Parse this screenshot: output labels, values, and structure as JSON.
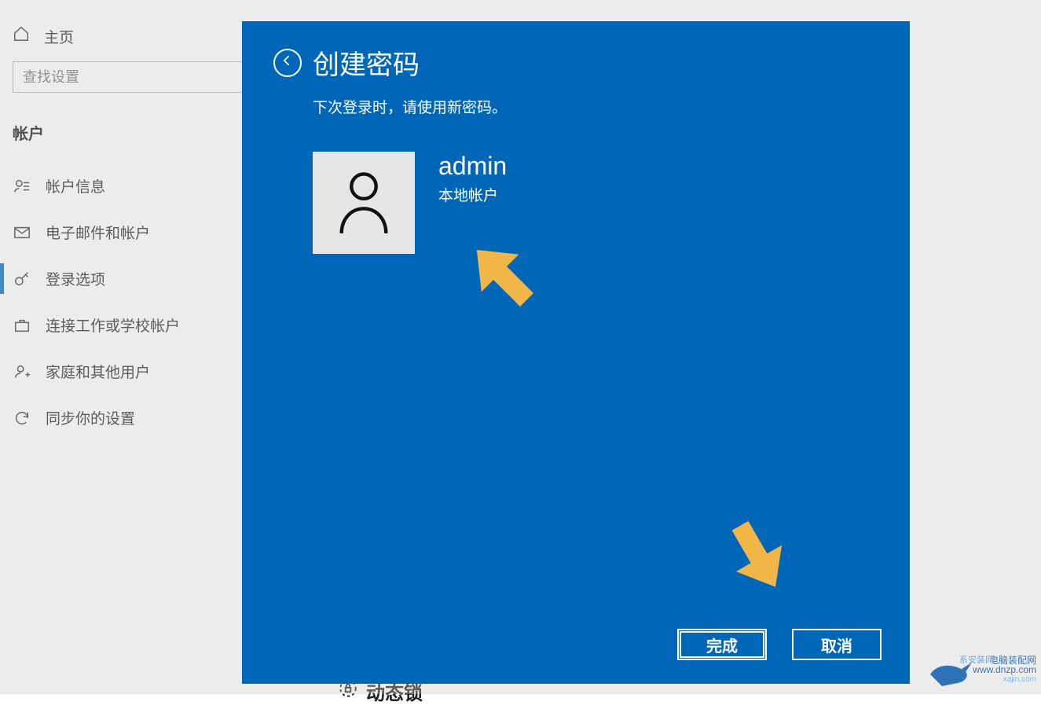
{
  "sidebar": {
    "home": "主页",
    "search_placeholder": "查找设置",
    "section": "帐户",
    "items": [
      {
        "id": "account-info",
        "label": "帐户信息"
      },
      {
        "id": "email-accounts",
        "label": "电子邮件和帐户"
      },
      {
        "id": "sign-in",
        "label": "登录选项"
      },
      {
        "id": "work-school",
        "label": "连接工作或学校帐户"
      },
      {
        "id": "family-users",
        "label": "家庭和其他用户"
      },
      {
        "id": "sync",
        "label": "同步你的设置"
      }
    ],
    "active_index": 2
  },
  "main": {
    "dynamic_lock_heading": "动态锁"
  },
  "dialog": {
    "title": "创建密码",
    "subtitle": "下次登录时，请使用新密码。",
    "user": {
      "name": "admin",
      "type": "本地帐户"
    },
    "buttons": {
      "finish": "完成",
      "cancel": "取消"
    }
  },
  "watermark": {
    "line1": "电脑装配网",
    "line2": "www.dnzp.com",
    "line3": "系安装网",
    "line4": "xajin.com"
  },
  "colors": {
    "dialog_bg": "#0067b8",
    "arrow_fill": "#f0b648"
  }
}
